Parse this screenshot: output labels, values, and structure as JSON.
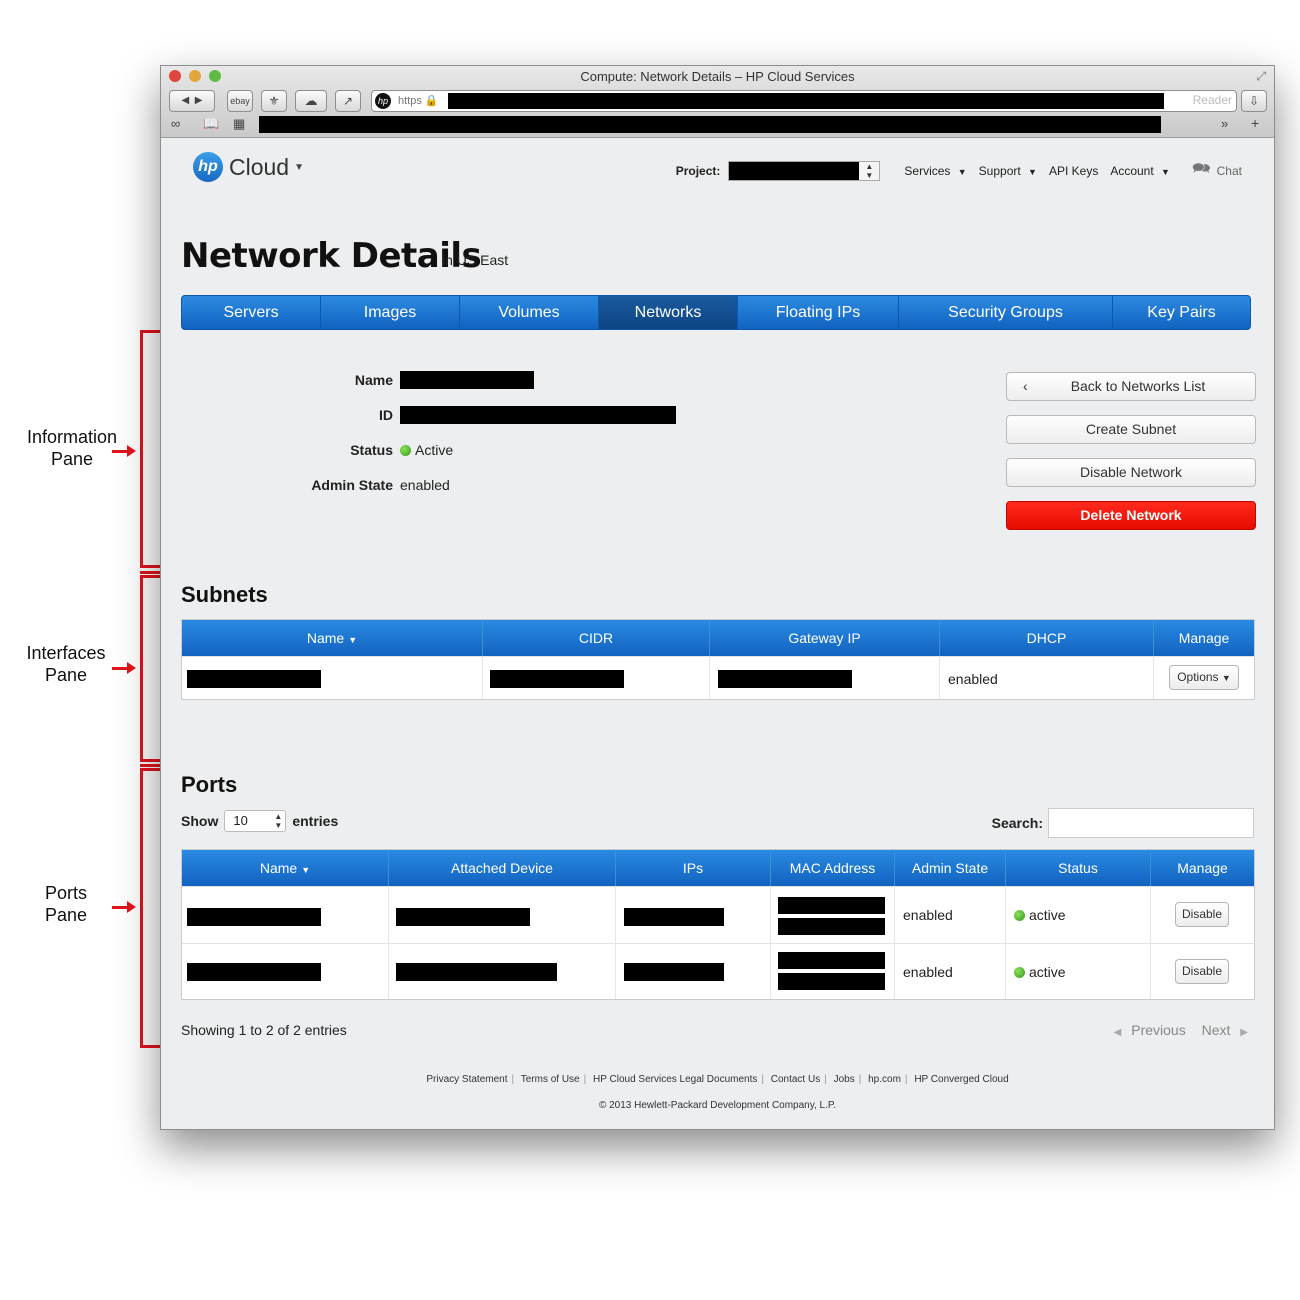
{
  "annotations": {
    "information_pane": [
      "Information",
      "Pane"
    ],
    "interfaces_pane": [
      "Interfaces",
      "Pane"
    ],
    "ports_pane": [
      "Ports",
      "Pane"
    ]
  },
  "window": {
    "title": "Compute: Network Details – HP Cloud Services",
    "toolbar": {
      "ebay_label": "ebay",
      "url_scheme": "https",
      "reader_label": "Reader"
    }
  },
  "header": {
    "logo_mark": "hp",
    "logo_text": "Cloud",
    "project_label": "Project:",
    "nav": [
      "Services",
      "Support",
      "API Keys",
      "Account"
    ],
    "chat_label": "Chat"
  },
  "page": {
    "title": "Network Details",
    "region": "in US East"
  },
  "tabs": [
    "Servers",
    "Images",
    "Volumes",
    "Networks",
    "Floating IPs",
    "Security Groups",
    "Key Pairs"
  ],
  "active_tab": "Networks",
  "info": {
    "name_label": "Name",
    "id_label": "ID",
    "status_label": "Status",
    "status_value": "Active",
    "admin_state_label": "Admin State",
    "admin_state_value": "enabled"
  },
  "actions": {
    "back": "Back to Networks List",
    "create_subnet": "Create Subnet",
    "disable_network": "Disable Network",
    "delete_network": "Delete Network"
  },
  "subnets": {
    "heading": "Subnets",
    "columns": [
      "Name",
      "CIDR",
      "Gateway IP",
      "DHCP",
      "Manage"
    ],
    "rows": [
      {
        "dhcp": "enabled",
        "manage": "Options"
      }
    ]
  },
  "ports": {
    "heading": "Ports",
    "show_label": "Show",
    "show_value": "10",
    "entries_label": "entries",
    "search_label": "Search:",
    "columns": [
      "Name",
      "Attached Device",
      "IPs",
      "MAC Address",
      "Admin State",
      "Status",
      "Manage"
    ],
    "rows": [
      {
        "admin_state": "enabled",
        "status": "active",
        "manage": "Disable"
      },
      {
        "admin_state": "enabled",
        "status": "active",
        "manage": "Disable"
      }
    ],
    "showing": "Showing 1 to 2 of 2 entries",
    "previous": "Previous",
    "next": "Next"
  },
  "footer": {
    "links": [
      "Privacy Statement",
      "Terms of Use",
      "HP Cloud Services Legal Documents",
      "Contact Us",
      "Jobs",
      "hp.com",
      "HP Converged Cloud"
    ],
    "copyright": "© 2013 Hewlett-Packard Development Company, L.P."
  },
  "colors": {
    "tab_blue": "#1163c0",
    "danger_red": "#e80a00",
    "annotation_red": "#e2141b",
    "status_green": "#2e9a1a"
  }
}
